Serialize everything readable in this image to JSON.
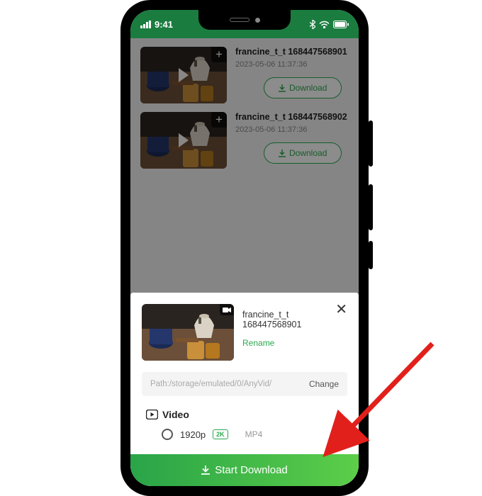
{
  "status": {
    "time": "9:41"
  },
  "items": [
    {
      "filename": "francine_t_t 168447568901",
      "date": "2023-05-06 11:37:36",
      "download_label": "Download"
    },
    {
      "filename": "francine_t_t 168447568902",
      "date": "2023-05-06 11:37:36",
      "download_label": "Download"
    }
  ],
  "sheet": {
    "title": "francine_t_t 168447568901",
    "rename_label": "Rename",
    "path_label": "Path:/storage/emulated/0/AnyVid/",
    "change_label": "Change",
    "section_label": "Video",
    "resolution": "1920p",
    "badge": "2K",
    "format": "MP4",
    "start_label": "Start Download"
  }
}
